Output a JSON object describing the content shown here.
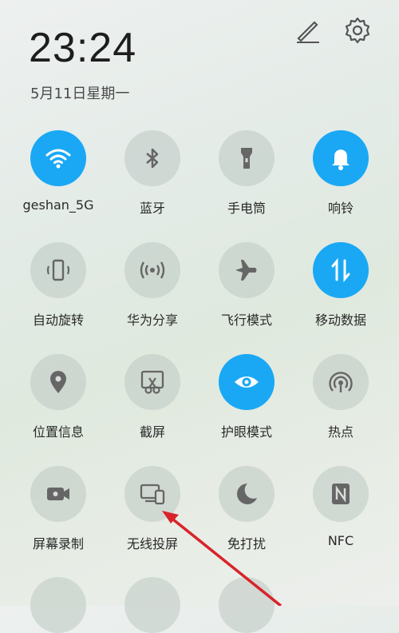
{
  "status": {
    "time": "23:24",
    "date": "5月11日星期一"
  },
  "header_icons": [
    {
      "name": "edit-icon"
    },
    {
      "name": "settings-icon"
    }
  ],
  "tiles": [
    {
      "label": "geshan_5G",
      "icon": "wifi-icon",
      "active": true
    },
    {
      "label": "蓝牙",
      "icon": "bluetooth-icon",
      "active": false
    },
    {
      "label": "手电筒",
      "icon": "flashlight-icon",
      "active": false
    },
    {
      "label": "响铃",
      "icon": "bell-icon",
      "active": true
    },
    {
      "label": "自动旋转",
      "icon": "auto-rotate-icon",
      "active": false
    },
    {
      "label": "华为分享",
      "icon": "huawei-share-icon",
      "active": false
    },
    {
      "label": "飞行模式",
      "icon": "airplane-icon",
      "active": false
    },
    {
      "label": "移动数据",
      "icon": "mobile-data-icon",
      "active": true
    },
    {
      "label": "位置信息",
      "icon": "location-icon",
      "active": false
    },
    {
      "label": "截屏",
      "icon": "screenshot-icon",
      "active": false
    },
    {
      "label": "护眼模式",
      "icon": "eye-icon",
      "active": true
    },
    {
      "label": "热点",
      "icon": "hotspot-icon",
      "active": false
    },
    {
      "label": "屏幕录制",
      "icon": "screen-record-icon",
      "active": false
    },
    {
      "label": "无线投屏",
      "icon": "wireless-projection-icon",
      "active": false
    },
    {
      "label": "免打扰",
      "icon": "do-not-disturb-icon",
      "active": false
    },
    {
      "label": "NFC",
      "icon": "nfc-icon",
      "active": false
    }
  ],
  "colors": {
    "active": "#1aa8f5",
    "inactive": "#c3cbc6",
    "annotation_arrow": "#d8232a"
  }
}
